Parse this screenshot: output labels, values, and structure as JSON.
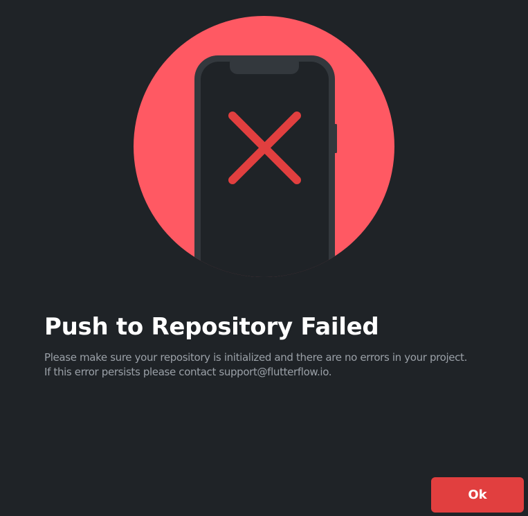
{
  "dialog": {
    "illustration_icon": "phone-with-x-icon",
    "title": "Push to Repository Failed",
    "message_line_1": "Please make sure your repository is initialized and there are no errors in your project.",
    "message_line_2": "If this error persists please contact support@flutterflow.io.",
    "ok_label": "Ok"
  },
  "colors": {
    "background": "#1f2327",
    "circle": "#ff5963",
    "phone_body": "#1f2327",
    "phone_frame": "#33383d",
    "error_x": "#e13f3f",
    "button": "#e13f3f",
    "title_text": "#ffffff",
    "message_text": "#9aa0a7"
  }
}
